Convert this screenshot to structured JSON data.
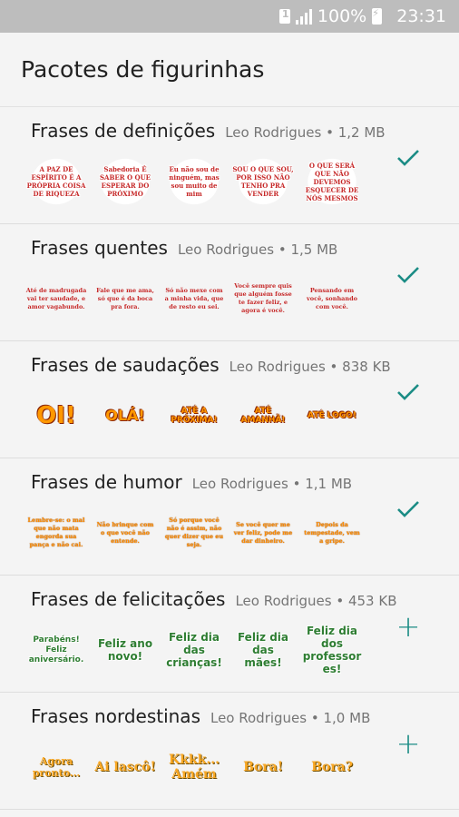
{
  "status_bar": {
    "sim_label": "1",
    "battery_text": "100%",
    "time": "23:31"
  },
  "app_bar": {
    "title": "Pacotes de figurinhas"
  },
  "accent_color": "#1b8c85",
  "packs": [
    {
      "title": "Frases de definições",
      "author": "Leo Rodrigues",
      "size": "1,2 MB",
      "installed": true,
      "stickers": [
        "A PAZ DE ESPÍRITO É A PRÓPRIA COISA DE RIQUEZA",
        "Sabedoria É SABER O QUE ESPERAR DO PRÓXIMO",
        "Eu não sou de ninguém, mas sou muito de mim",
        "SOU O QUE SOU, POR ISSO NÃO TENHO PRA VENDER",
        "O QUE SERÁ QUE NÃO DEVEMOS ESQUECER DE NÓS MESMOS"
      ]
    },
    {
      "title": "Frases quentes",
      "author": "Leo Rodrigues",
      "size": "1,5 MB",
      "installed": true,
      "stickers": [
        "Até de madrugada vai ter saudade, e amor vagabundo.",
        "Fale que me ama, só que é da boca pra fora.",
        "Só não mexe com a minha vida, que de resto eu sei.",
        "Você sempre quis que alguém fosse te fazer feliz, e agora é você.",
        "Pensando em você, sonhando com você."
      ]
    },
    {
      "title": "Frases de saudações",
      "author": "Leo Rodrigues",
      "size": "838 KB",
      "installed": true,
      "stickers": [
        "OI!",
        "OLÁ!",
        "ATÉ A PRÓXIMA!",
        "ATÉ AMANHÃ!",
        "ATÉ LOGO!"
      ]
    },
    {
      "title": "Frases de humor",
      "author": "Leo Rodrigues",
      "size": "1,1 MB",
      "installed": true,
      "stickers": [
        "Lembre-se: o mal que não mata engorda sua pança e não cai.",
        "Não brinque com o que você não entende.",
        "Só porque você não é assim, não quer dizer que eu seja.",
        "Se você quer me ver feliz, pode me dar dinheiro.",
        "Depois da tempestade, vem a gripe."
      ]
    },
    {
      "title": "Frases de felicitações",
      "author": "Leo Rodrigues",
      "size": "453 KB",
      "installed": false,
      "stickers": [
        "Parabéns! Feliz aniversário.",
        "Feliz ano novo!",
        "Feliz dia das crianças!",
        "Feliz dia das mães!",
        "Feliz dia dos professores!"
      ]
    },
    {
      "title": "Frases nordestinas",
      "author": "Leo Rodrigues",
      "size": "1,0 MB",
      "installed": false,
      "stickers": [
        "Agora pronto...",
        "Ai lascô!",
        "Kkkk... Amém",
        "Bora!",
        "Bora?"
      ]
    }
  ]
}
